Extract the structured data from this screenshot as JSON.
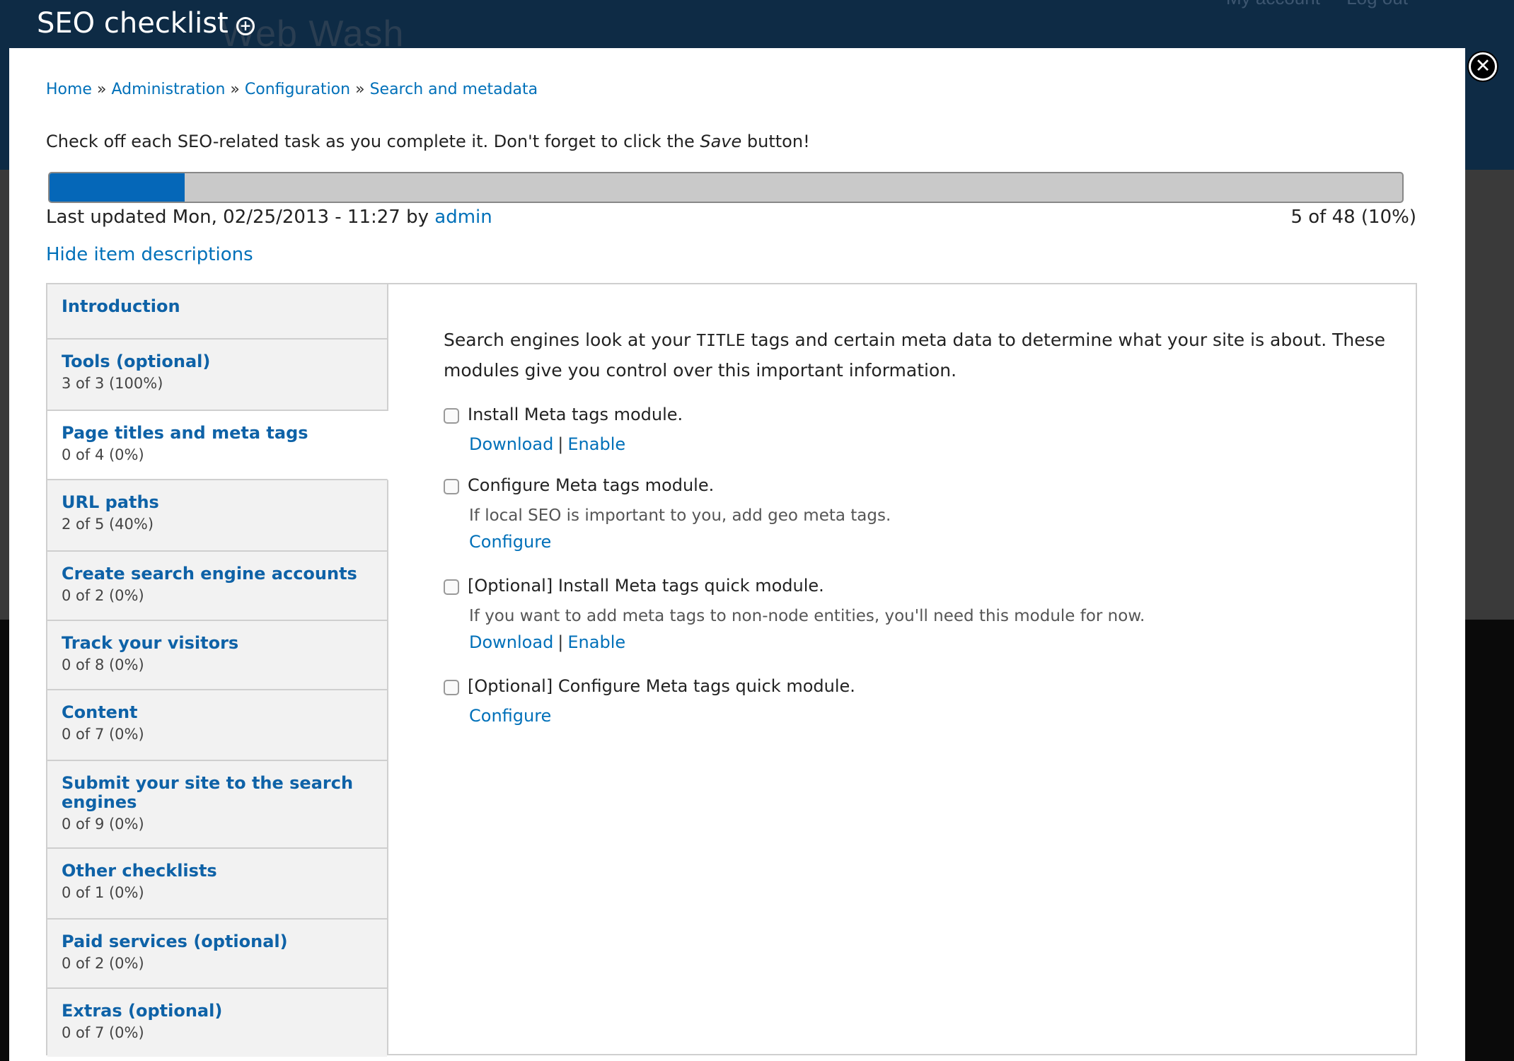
{
  "background": {
    "site_name": "Web Wash",
    "user_nav": [
      "My account",
      "Log out"
    ]
  },
  "overlay": {
    "title": "SEO checklist",
    "shortcut_icon": "plus-circle-icon",
    "close_icon": "close-icon",
    "close_glyph": "✕",
    "shortcut_glyph": "+"
  },
  "breadcrumb": [
    "Home",
    "Administration",
    "Configuration",
    "Search and metadata"
  ],
  "breadcrumb_separator": "»",
  "intro": {
    "before": "Check off each SEO-related task as you complete it. Don't forget to click the ",
    "emphasis": "Save",
    "after": " button!"
  },
  "progress": {
    "fraction": 0.1,
    "text": "5 of 48 (10%)"
  },
  "last_updated": {
    "prefix": "Last updated Mon, 02/25/2013 - 11:27 by ",
    "user": "admin"
  },
  "toggle_descriptions": "Hide item descriptions",
  "tabs": [
    {
      "title": "Introduction",
      "summary": ""
    },
    {
      "title": "Tools (optional)",
      "summary": "3 of 3 (100%)"
    },
    {
      "title": "Page titles and meta tags",
      "summary": "0 of 4 (0%)",
      "selected": true
    },
    {
      "title": "URL paths",
      "summary": "2 of 5 (40%)"
    },
    {
      "title": "Create search engine accounts",
      "summary": "0 of 2 (0%)"
    },
    {
      "title": "Track your visitors",
      "summary": "0 of 8 (0%)"
    },
    {
      "title": "Content",
      "summary": "0 of 7 (0%)"
    },
    {
      "title": "Submit your site to the search engines",
      "summary": "0 of 9 (0%)"
    },
    {
      "title": "Other checklists",
      "summary": "0 of 1 (0%)"
    },
    {
      "title": "Paid services (optional)",
      "summary": "0 of 2 (0%)"
    },
    {
      "title": "Extras (optional)",
      "summary": "0 of 7 (0%)"
    }
  ],
  "pane": {
    "intro_before": "Search engines look at your ",
    "intro_code": "TITLE",
    "intro_after": " tags and certain meta data to determine what your site is about. These modules give you control over this important information.",
    "items": [
      {
        "label": "Install Meta tags module.",
        "checked": false,
        "description": "",
        "links": [
          "Download",
          "Enable"
        ]
      },
      {
        "label": "Configure Meta tags module.",
        "checked": false,
        "description": "If local SEO is important to you, add geo meta tags.",
        "links": [
          "Configure"
        ]
      },
      {
        "label": "[Optional] Install Meta tags quick module.",
        "checked": false,
        "description": "If you want to add meta tags to non-node entities, you'll need this module for now.",
        "links": [
          "Download",
          "Enable"
        ]
      },
      {
        "label": "[Optional] Configure Meta tags quick module.",
        "checked": false,
        "description": "",
        "links": [
          "Configure"
        ]
      }
    ],
    "link_separator": "|"
  },
  "colors": {
    "link": "#0070b9",
    "tab_title": "#0e62a7",
    "progress_fill": "#0567b8",
    "header_bg": "#0e2b45"
  }
}
